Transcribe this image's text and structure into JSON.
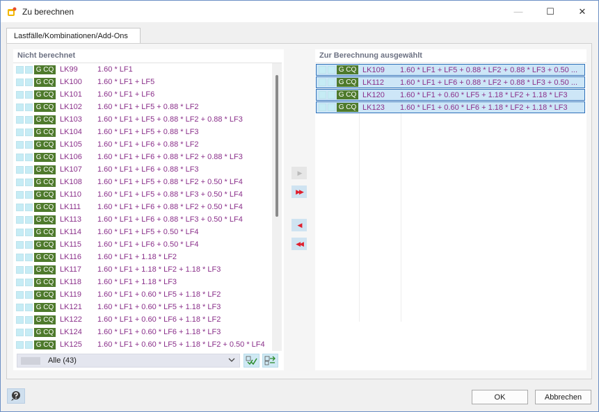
{
  "window": {
    "title": "Zu berechnen",
    "minimize_glyph": "—",
    "maximize_glyph": "☐",
    "close_glyph": "✕"
  },
  "tab_label": "Lastfälle/Kombinationen/Add-Ons",
  "left_panel": {
    "header": "Nicht berechnet",
    "tag": "G CQ",
    "rows": [
      {
        "name": "LK99",
        "formula": "1.60 * LF1"
      },
      {
        "name": "LK100",
        "formula": "1.60 * LF1 + LF5"
      },
      {
        "name": "LK101",
        "formula": "1.60 * LF1 + LF6"
      },
      {
        "name": "LK102",
        "formula": "1.60 * LF1 + LF5 + 0.88 * LF2"
      },
      {
        "name": "LK103",
        "formula": "1.60 * LF1 + LF5 + 0.88 * LF2 + 0.88 * LF3"
      },
      {
        "name": "LK104",
        "formula": "1.60 * LF1 + LF5 + 0.88 * LF3"
      },
      {
        "name": "LK105",
        "formula": "1.60 * LF1 + LF6 + 0.88 * LF2"
      },
      {
        "name": "LK106",
        "formula": "1.60 * LF1 + LF6 + 0.88 * LF2 + 0.88 * LF3"
      },
      {
        "name": "LK107",
        "formula": "1.60 * LF1 + LF6 + 0.88 * LF3"
      },
      {
        "name": "LK108",
        "formula": "1.60 * LF1 + LF5 + 0.88 * LF2 + 0.50 * LF4"
      },
      {
        "name": "LK110",
        "formula": "1.60 * LF1 + LF5 + 0.88 * LF3 + 0.50 * LF4"
      },
      {
        "name": "LK111",
        "formula": "1.60 * LF1 + LF6 + 0.88 * LF2 + 0.50 * LF4"
      },
      {
        "name": "LK113",
        "formula": "1.60 * LF1 + LF6 + 0.88 * LF3 + 0.50 * LF4"
      },
      {
        "name": "LK114",
        "formula": "1.60 * LF1 + LF5 + 0.50 * LF4"
      },
      {
        "name": "LK115",
        "formula": "1.60 * LF1 + LF6 + 0.50 * LF4"
      },
      {
        "name": "LK116",
        "formula": "1.60 * LF1 + 1.18 * LF2"
      },
      {
        "name": "LK117",
        "formula": "1.60 * LF1 + 1.18 * LF2 + 1.18 * LF3"
      },
      {
        "name": "LK118",
        "formula": "1.60 * LF1 + 1.18 * LF3"
      },
      {
        "name": "LK119",
        "formula": "1.60 * LF1 + 0.60 * LF5 + 1.18 * LF2"
      },
      {
        "name": "LK121",
        "formula": "1.60 * LF1 + 0.60 * LF5 + 1.18 * LF3"
      },
      {
        "name": "LK122",
        "formula": "1.60 * LF1 + 0.60 * LF6 + 1.18 * LF2"
      },
      {
        "name": "LK124",
        "formula": "1.60 * LF1 + 0.60 * LF6 + 1.18 * LF3"
      },
      {
        "name": "LK125",
        "formula": "1.60 * LF1 + 0.60 * LF5 + 1.18 * LF2 + 0.50 * LF4"
      }
    ],
    "filter_value": "Alle (43)"
  },
  "right_panel": {
    "header": "Zur Berechnung ausgewählt",
    "tag": "G CQ",
    "rows": [
      {
        "name": "LK109",
        "formula": "1.60 * LF1 + LF5 + 0.88 * LF2 + 0.88 * LF3 + 0.50 ..."
      },
      {
        "name": "LK112",
        "formula": "1.60 * LF1 + LF6 + 0.88 * LF2 + 0.88 * LF3 + 0.50 ..."
      },
      {
        "name": "LK120",
        "formula": "1.60 * LF1 + 0.60 * LF5 + 1.18 * LF2 + 1.18 * LF3"
      },
      {
        "name": "LK123",
        "formula": "1.60 * LF1 + 0.60 * LF6 + 1.18 * LF2 + 1.18 * LF3"
      }
    ]
  },
  "transfer": {
    "add_one": "▶",
    "add_all": "▶▶",
    "remove_one": "◀",
    "remove_all": "◀◀"
  },
  "footer": {
    "ok_label": "OK",
    "cancel_label": "Abbrechen"
  },
  "colors": {
    "accent": "#2d6fb8",
    "formula_text": "#8a2f8a",
    "tag_bg": "#4e7a2c",
    "arrow_red": "#e0202e"
  }
}
